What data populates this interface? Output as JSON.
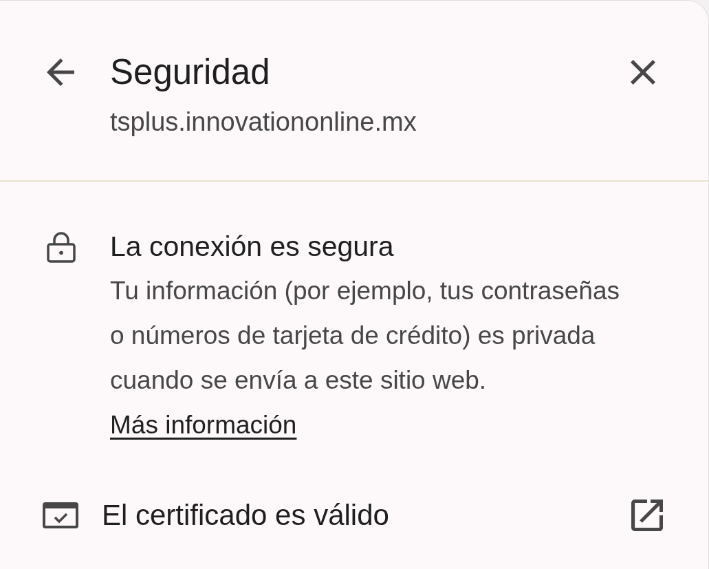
{
  "header": {
    "title": "Seguridad",
    "subtitle": "tsplus.innovationonline.mx"
  },
  "connection": {
    "heading": "La conexión es segura",
    "text": "Tu información (por ejemplo, tus contraseñas o números de tarjeta de crédito) es privada cuando se envía a este sitio web.",
    "link": "Más información"
  },
  "certificate": {
    "label": "El certificado es válido"
  }
}
